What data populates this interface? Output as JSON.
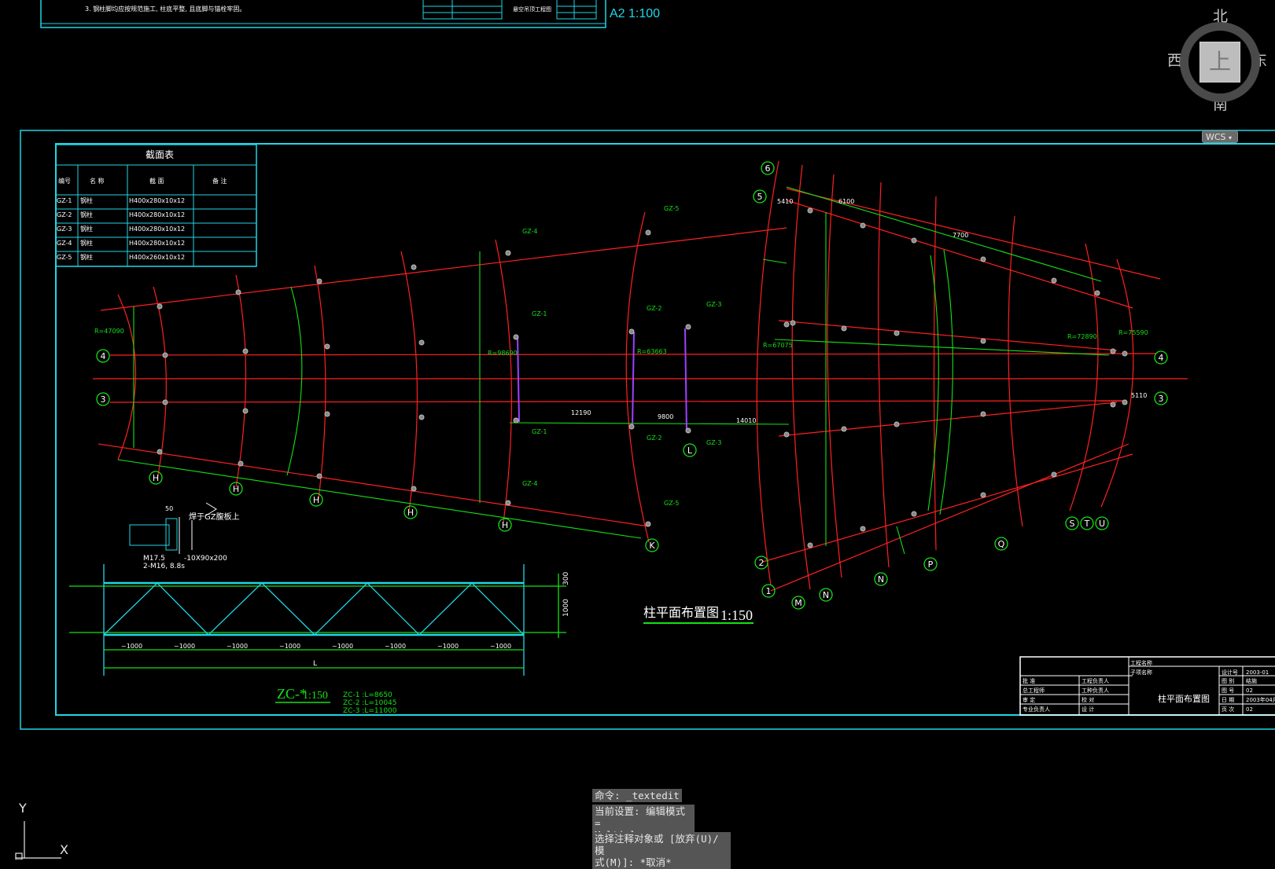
{
  "sheet": {
    "scale_label": "A2 1:100",
    "top_note": "3. 钢柱脚均应按规范施工, 柱底平整, 且底脚与锚栓牢固。",
    "top_caption": "悬空吊顶工程图"
  },
  "section_table": {
    "title": "截面表",
    "headers": [
      "编号",
      "名 称",
      "截 面",
      "备 注"
    ],
    "rows": [
      {
        "code": "GZ-1",
        "name": "钢柱",
        "section": "H400x280x10x12",
        "note": ""
      },
      {
        "code": "GZ-2",
        "name": "钢柱",
        "section": "H400x280x10x12",
        "note": ""
      },
      {
        "code": "GZ-3",
        "name": "钢柱",
        "section": "H400x280x10x12",
        "note": ""
      },
      {
        "code": "GZ-4",
        "name": "钢柱",
        "section": "H400x280x10x12",
        "note": ""
      },
      {
        "code": "GZ-5",
        "name": "钢柱",
        "section": "H400x260x10x12",
        "note": ""
      }
    ]
  },
  "plan": {
    "title": "柱平面布置图",
    "scale": "1:150",
    "column_tags": [
      "GZ-1",
      "GZ-1",
      "GZ-2",
      "GZ-2",
      "GZ-3",
      "GZ-3",
      "GZ-4",
      "GZ-4",
      "GZ-5",
      "GZ-5"
    ],
    "radius_labels": [
      "R=47090",
      "R=98690",
      "R=63663",
      "R=67075",
      "R=72890",
      "R=75590"
    ],
    "dims": [
      "12190",
      "9800",
      "14010",
      "5410",
      "6100",
      "7700",
      "5110"
    ],
    "grid_left": [
      "4",
      "3"
    ],
    "grid_right": [
      "4",
      "3"
    ],
    "grid_upper": [
      "6",
      "5"
    ],
    "grid_lower": [
      "2",
      "1"
    ],
    "grid_bottom": [
      "H",
      "H",
      "H",
      "H",
      "H",
      "K",
      "L"
    ],
    "grid_arc_bottom": [
      "M",
      "N",
      "N",
      "P",
      "Q",
      "S",
      "T",
      "U"
    ]
  },
  "detail": {
    "note_main": "焊于GZ腹板上",
    "note_bolt1": "M17.5",
    "note_bolt2": "2-M16, 8.8s",
    "note_plate": "-10X90x200",
    "dim_50": "50"
  },
  "truss": {
    "title": "ZC-*",
    "scale": "1:150",
    "lengths": [
      "ZC-1 :L=8650",
      "ZC-2 :L=10045",
      "ZC-3 :L=11000"
    ],
    "bay_labels": [
      "~1000",
      "~1000",
      "~1000",
      "~1000",
      "~1000",
      "~1000",
      "~1000",
      "~1000"
    ],
    "overall": "L",
    "h1": "300",
    "h2": "1000"
  },
  "title_block": {
    "drawing_name": "柱平面布置图",
    "project_label": "工程名称",
    "subitem_label": "子项名称",
    "rows_left": [
      "批 准",
      "总工程师",
      "审 定",
      "专业负责人"
    ],
    "rows_mid": [
      "工程负责人",
      "工种负责人",
      "校 对",
      "设 计"
    ],
    "rows_right_k": [
      "设计号",
      "图 别",
      "图 号",
      "日 期",
      "页 次"
    ],
    "rows_right_v": [
      "2003-01",
      "结施",
      "02",
      "2003年04月",
      "02"
    ]
  },
  "viewcube": {
    "north": "北",
    "south": "南",
    "west": "西",
    "east": "东",
    "face": "上",
    "wcs": "WCS"
  },
  "command": {
    "line1": "命令: _textedit",
    "line2a": "当前设置: 编辑模式 =",
    "line2b": "Multiple",
    "line3a": "选择注释对象或 [放弃(U)/模",
    "line3b": "式(M)]: *取消*"
  },
  "ucs": {
    "x": "X",
    "y": "Y"
  },
  "colors": {
    "red": "#ff2020",
    "green": "#16e016",
    "cyan": "#20d6e6",
    "white": "#ffffff",
    "magenta": "#a040ff"
  }
}
